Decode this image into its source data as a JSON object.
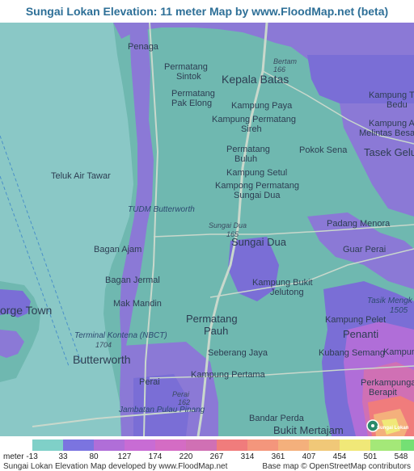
{
  "title": "Sungai Lokan Elevation: 11 meter Map by www.FloodMap.net (beta)",
  "colors": {
    "sea": "#8ac8c6",
    "land": "#6fb8b0",
    "low": "#8b79d6",
    "lowdark": "#6a5dc9",
    "road": "#b9cfc2",
    "title": "#2d6f97"
  },
  "places": [
    {
      "id": "penaga",
      "text": "Penaga"
    },
    {
      "id": "bertam",
      "text": "Bertam"
    },
    {
      "id": "r166",
      "text": "166"
    },
    {
      "id": "permatang-sintok-1",
      "text": "Permatang"
    },
    {
      "id": "permatang-sintok-2",
      "text": "Sintok"
    },
    {
      "id": "kepala-batas",
      "text": "Kepala Batas"
    },
    {
      "id": "permatang-pak-elong-1",
      "text": "Permatang"
    },
    {
      "id": "permatang-pak-elong-2",
      "text": "Pak Elong"
    },
    {
      "id": "kampung-paya",
      "text": "Kampung Paya"
    },
    {
      "id": "kampung-tok-bedu-1",
      "text": "Kampung Tok"
    },
    {
      "id": "kampung-tok-bedu-2",
      "text": "Bedu"
    },
    {
      "id": "kampung-permatang-sireh-1",
      "text": "Kampung Permatang"
    },
    {
      "id": "kampung-permatang-sireh-2",
      "text": "Sireh"
    },
    {
      "id": "kampung-air-melintas-1",
      "text": "Kampung Air"
    },
    {
      "id": "kampung-air-melintas-2",
      "text": "Melintas Besar"
    },
    {
      "id": "permatang-buluh-1",
      "text": "Permatang"
    },
    {
      "id": "permatang-buluh-2",
      "text": "Buluh"
    },
    {
      "id": "pokok-sena",
      "text": "Pokok Sena"
    },
    {
      "id": "tasek-gelugor",
      "text": "Tasek Gelu"
    },
    {
      "id": "teluk-air-tawar",
      "text": "Teluk Air Tawar"
    },
    {
      "id": "kampung-setul",
      "text": "Kampung Setul"
    },
    {
      "id": "kampong-permatang-sungai-dua-1",
      "text": "Kampong Permatang"
    },
    {
      "id": "kampong-permatang-sungai-dua-2",
      "text": "Sungai Dua"
    },
    {
      "id": "tudm-butterworth",
      "text": "TUDM Butterworth"
    },
    {
      "id": "sungai-dua-road",
      "text": "Sungai Dua"
    },
    {
      "id": "r165",
      "text": "165"
    },
    {
      "id": "padang-menora",
      "text": "Padang Menora"
    },
    {
      "id": "sungai-dua",
      "text": "Sungai Dua"
    },
    {
      "id": "bagan-ajam",
      "text": "Bagan Ajam"
    },
    {
      "id": "guar-perai",
      "text": "Guar Perai"
    },
    {
      "id": "bagan-jermal",
      "text": "Bagan Jermal"
    },
    {
      "id": "kampung-bukit-jelutong-1",
      "text": "Kampung Bukit"
    },
    {
      "id": "kampung-bukit-jelutong-2",
      "text": "Jelutong"
    },
    {
      "id": "george-town",
      "text": "orge Town"
    },
    {
      "id": "mak-mandin",
      "text": "Mak Mandin"
    },
    {
      "id": "tasik-mengkuang",
      "text": "Tasik Mengk"
    },
    {
      "id": "r1505",
      "text": "1505"
    },
    {
      "id": "terminal-kontena",
      "text": "Terminal Kontena (NBCT)"
    },
    {
      "id": "permatang-pauh-1",
      "text": "Permatang"
    },
    {
      "id": "permatang-pauh-2",
      "text": "Pauh"
    },
    {
      "id": "kampung-pelet",
      "text": "Kampung Pelet"
    },
    {
      "id": "penanti",
      "text": "Penanti"
    },
    {
      "id": "r1704",
      "text": "1704"
    },
    {
      "id": "butterworth",
      "text": "Butterworth"
    },
    {
      "id": "seberang-jaya",
      "text": "Seberang Jaya"
    },
    {
      "id": "kubang-semang",
      "text": "Kubang Semang"
    },
    {
      "id": "kampung-right",
      "text": "Kampung"
    },
    {
      "id": "kampung-pertama",
      "text": "Kampung Pertama"
    },
    {
      "id": "perai",
      "text": "Perai"
    },
    {
      "id": "perai-road",
      "text": "Perai"
    },
    {
      "id": "r162",
      "text": "162"
    },
    {
      "id": "perkampungan-berapit-1",
      "text": "Perkampungan"
    },
    {
      "id": "perkampungan-berapit-2",
      "text": "Berapit"
    },
    {
      "id": "jambatan",
      "text": "Jambatan Pulau Pinang"
    },
    {
      "id": "bandar-perda",
      "text": "Bandar Perda"
    },
    {
      "id": "bukit-mertajam",
      "text": "Bukit Mertajam"
    }
  ],
  "pin_label": "Sungai Lokan",
  "legend": {
    "unit_label": "meter",
    "items": [
      {
        "value": "-13",
        "color": "#7fd0c8"
      },
      {
        "value": "33",
        "color": "#7b74e0"
      },
      {
        "value": "80",
        "color": "#b06ed8"
      },
      {
        "value": "127",
        "color": "#c86cd4"
      },
      {
        "value": "174",
        "color": "#d46cc4"
      },
      {
        "value": "220",
        "color": "#d070b4"
      },
      {
        "value": "267",
        "color": "#f07c7c"
      },
      {
        "value": "314",
        "color": "#f4967c"
      },
      {
        "value": "361",
        "color": "#f4b07c"
      },
      {
        "value": "407",
        "color": "#f0c878"
      },
      {
        "value": "454",
        "color": "#f0e878"
      },
      {
        "value": "501",
        "color": "#a4e878"
      },
      {
        "value": "548",
        "color": "#74e074"
      }
    ]
  },
  "credits": {
    "left": "Sungai Lokan Elevation Map developed by www.FloodMap.net",
    "right": "Base map © OpenStreetMap contributors"
  }
}
